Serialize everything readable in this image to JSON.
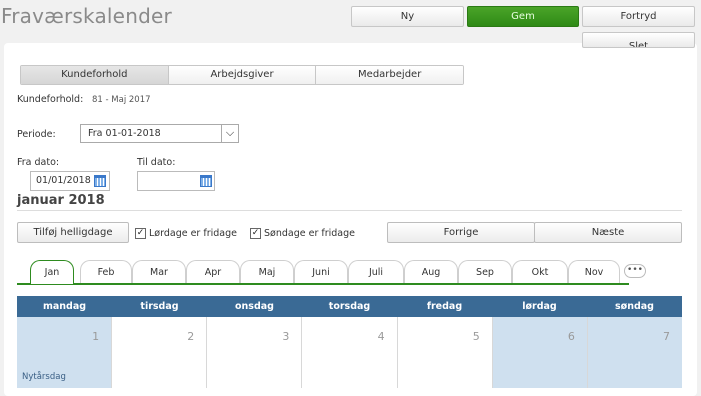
{
  "header": {
    "title": "Fraværskalender",
    "buttons": {
      "new": "Ny",
      "save": "Gem",
      "undo": "Fortryd",
      "delete": "Slet"
    },
    "save_color": "#37941d"
  },
  "tabs": [
    "Kundeforhold",
    "Arbejdsgiver",
    "Medarbejder"
  ],
  "customer": {
    "label": "Kundeforhold:",
    "value": "81 - Maj 2017"
  },
  "period": {
    "label": "Periode:",
    "selected": "Fra 01-01-2018"
  },
  "dates": {
    "from_label": "Fra dato:",
    "from_value": "01/01/2018",
    "to_label": "Til dato:",
    "to_value": ""
  },
  "month_heading": "januar 2018",
  "actions": {
    "add_holidays": "Tilføj helligdage",
    "saturday": "Lørdage er fridage",
    "sunday": "Søndage er fridage",
    "saturday_checked": true,
    "sunday_checked": true,
    "prev": "Forrige",
    "next": "Næste"
  },
  "months": [
    "Jan",
    "Feb",
    "Mar",
    "Apr",
    "Maj",
    "Juni",
    "Juli",
    "Aug",
    "Sep",
    "Okt",
    "Nov"
  ],
  "more": "•••",
  "weekdays": [
    "mandag",
    "tirsdag",
    "onsdag",
    "torsdag",
    "fredag",
    "lørdag",
    "søndag"
  ],
  "days": [
    {
      "num": "1",
      "note": "Nytårsdag",
      "highlight": true
    },
    {
      "num": "2",
      "note": "",
      "highlight": false
    },
    {
      "num": "3",
      "note": "",
      "highlight": false
    },
    {
      "num": "4",
      "note": "",
      "highlight": false
    },
    {
      "num": "5",
      "note": "",
      "highlight": false
    },
    {
      "num": "6",
      "note": "",
      "highlight": true
    },
    {
      "num": "7",
      "note": "",
      "highlight": true
    }
  ],
  "colors": {
    "accent": "#2e8b1f",
    "calendar_header": "#3a6a95",
    "highlight": "#cfe0ef"
  }
}
